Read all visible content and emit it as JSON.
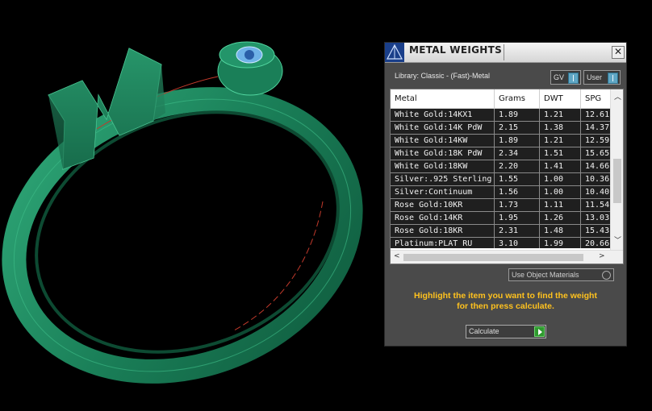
{
  "window": {
    "title": "METAL WEIGHTS",
    "close_glyph": "✕"
  },
  "library": {
    "label": "Library: Classic - (Fast)-Metal"
  },
  "toggles": {
    "gv_label": "GV",
    "user_label": "User"
  },
  "table": {
    "columns": [
      "Metal",
      "Grams",
      "DWT",
      "SPG"
    ],
    "rows": [
      [
        "White Gold:14KX1",
        "1.89",
        "1.21",
        "12.61"
      ],
      [
        "White Gold:14K PdW",
        "2.15",
        "1.38",
        "14.37"
      ],
      [
        "White Gold:14KW",
        "1.89",
        "1.21",
        "12.59"
      ],
      [
        "White Gold:18K PdW",
        "2.34",
        "1.51",
        "15.65"
      ],
      [
        "White Gold:18KW",
        "2.20",
        "1.41",
        "14.66"
      ],
      [
        "Silver:.925 Sterling",
        "1.55",
        "1.00",
        "10.36"
      ],
      [
        "Silver:Continuum",
        "1.56",
        "1.00",
        "10.40"
      ],
      [
        "Rose Gold:10KR",
        "1.73",
        "1.11",
        "11.54"
      ],
      [
        "Rose Gold:14KR",
        "1.95",
        "1.26",
        "13.03"
      ],
      [
        "Rose Gold:18KR",
        "2.31",
        "1.48",
        "15.43"
      ],
      [
        "Platinum:PLAT RU",
        "3.10",
        "1.99",
        "20.66"
      ]
    ]
  },
  "use_object_materials": {
    "label": "Use Object Materials"
  },
  "hint": {
    "line1": "Highlight the item you want to find the weight",
    "line2": "for then press calculate."
  },
  "calculate": {
    "label": "Calculate"
  },
  "colors": {
    "accent": "#ffc21e",
    "ring": "#1e7f58",
    "background": "#000000"
  }
}
